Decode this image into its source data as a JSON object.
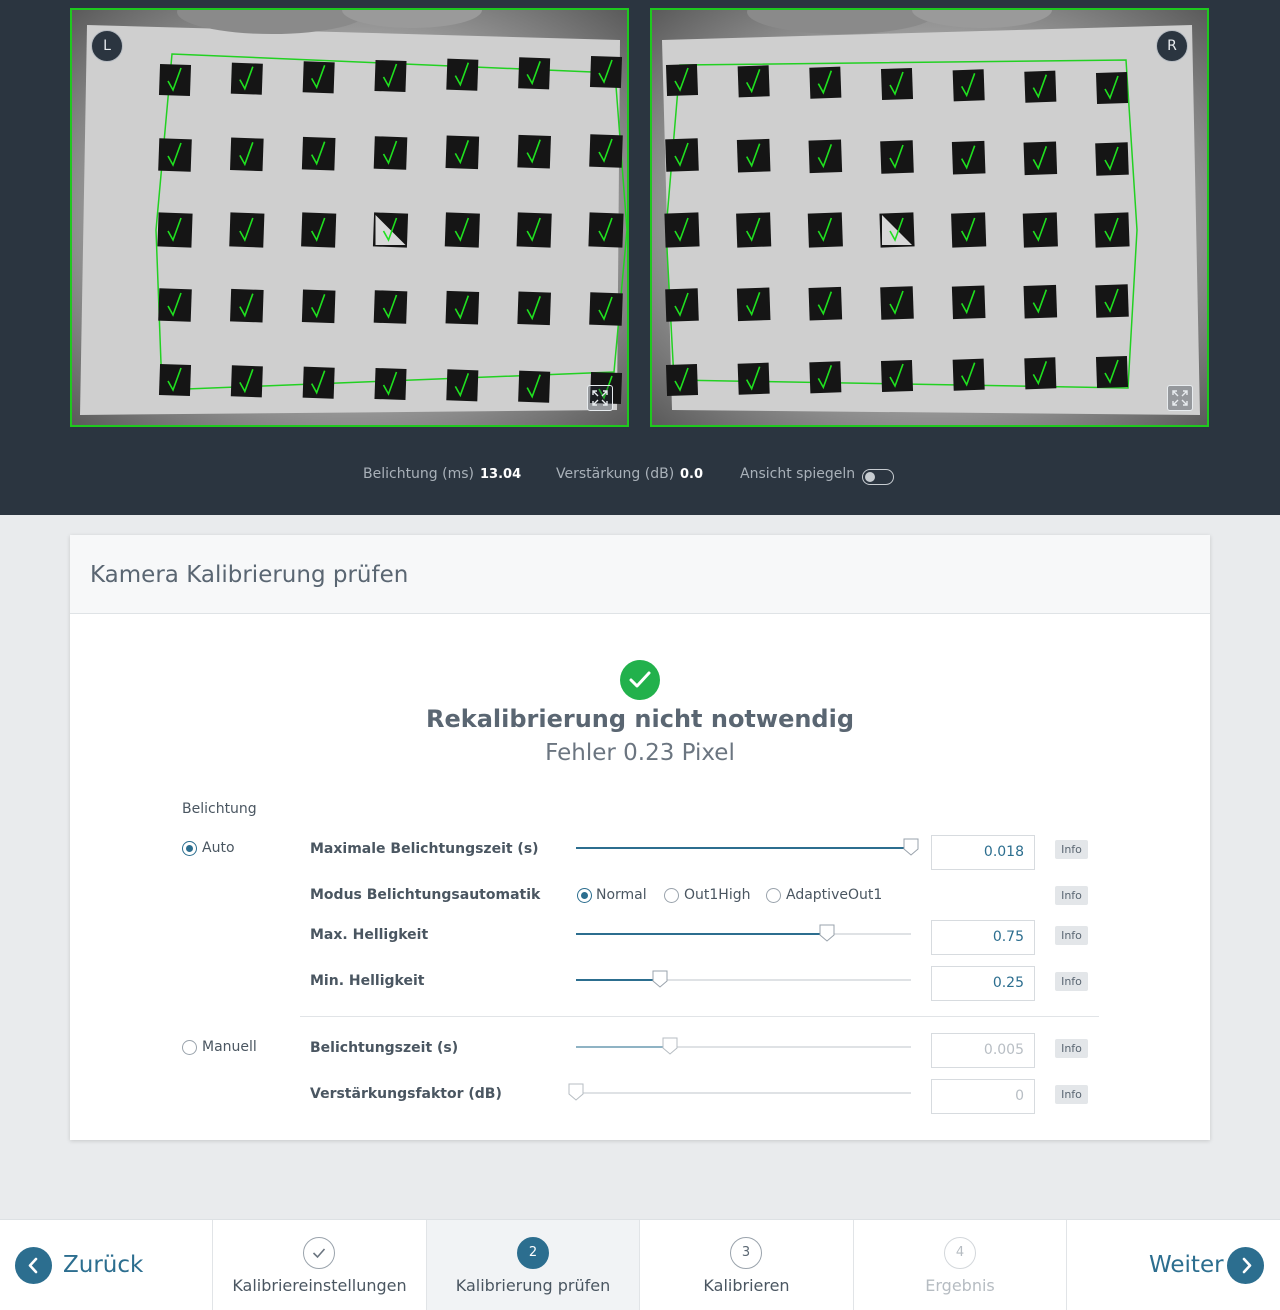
{
  "cameras": {
    "left_badge": "L",
    "right_badge": "R"
  },
  "camera_stats": {
    "exposure_label": "Belichtung (ms)",
    "exposure_value": "13.04",
    "gain_label": "Verstärkung (dB)",
    "gain_value": "0.0",
    "mirror_label": "Ansicht spiegeln",
    "mirror_on": false
  },
  "panel": {
    "title": "Kamera Kalibrierung prüfen",
    "status_title": "Rekalibrierung nicht notwendig",
    "status_sub": "Fehler 0.23 Pixel",
    "status_color": "#22b14c",
    "section_label": "Belichtung",
    "auto_label": "Auto",
    "manual_label": "Manuell",
    "mode_selected": "Auto",
    "info_label": "Info",
    "rows": {
      "max_exposure": {
        "label": "Maximale Belichtungszeit (s)",
        "value": "0.018",
        "fraction": 1.0
      },
      "mode": {
        "label": "Modus Belichtungsautomatik",
        "options": [
          "Normal",
          "Out1High",
          "AdaptiveOut1"
        ],
        "selected": "Normal"
      },
      "max_brightness": {
        "label": "Max. Helligkeit",
        "value": "0.75",
        "fraction": 0.75
      },
      "min_brightness": {
        "label": "Min. Helligkeit",
        "value": "0.25",
        "fraction": 0.25
      },
      "exposure_time": {
        "label": "Belichtungszeit (s)",
        "value": "0.005",
        "fraction": 0.28
      },
      "gain_factor": {
        "label": "Verstärkungsfaktor (dB)",
        "value": "0",
        "fraction": 0.0
      }
    }
  },
  "footer": {
    "back_label": "Zurück",
    "next_label": "Weiter",
    "accent": "#2c6e8f",
    "steps": [
      {
        "number": "1",
        "label": "Kalibriereinstellungen",
        "state": "done"
      },
      {
        "number": "2",
        "label": "Kalibrierung prüfen",
        "state": "current"
      },
      {
        "number": "3",
        "label": "Kalibrieren",
        "state": "pending"
      },
      {
        "number": "4",
        "label": "Ergebnis",
        "state": "disabled"
      }
    ]
  }
}
